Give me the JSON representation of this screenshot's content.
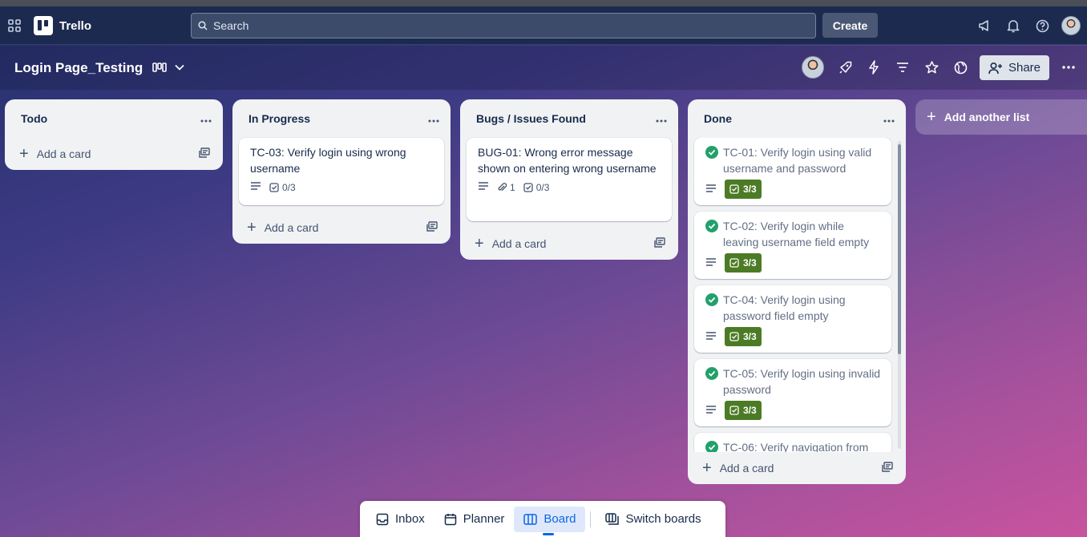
{
  "app": {
    "name": "Trello"
  },
  "topbar": {
    "search_placeholder": "Search",
    "create_label": "Create"
  },
  "board": {
    "title": "Login Page_Testing",
    "share_label": "Share"
  },
  "lists": [
    {
      "title": "Todo",
      "add_card": "Add a card",
      "cards": []
    },
    {
      "title": "In Progress",
      "add_card": "Add a card",
      "cards": [
        {
          "title": "TC-03: Verify login using wrong username",
          "checklist": "0/3"
        }
      ]
    },
    {
      "title": "Bugs / Issues Found",
      "add_card": "Add a card",
      "cards": [
        {
          "title": "BUG-01: Wrong error message shown on entering wrong username",
          "attachments": "1",
          "checklist": "0/3"
        }
      ]
    },
    {
      "title": "Done",
      "add_card": "Add a card",
      "cards": [
        {
          "title": "TC-01: Verify login using valid username and password",
          "checklist": "3/3"
        },
        {
          "title": "TC-02: Verify login while leaving username field empty",
          "checklist": "3/3"
        },
        {
          "title": "TC-04: Verify login using password field empty",
          "checklist": "3/3"
        },
        {
          "title": "TC-05: Verify login using invalid password",
          "checklist": "3/3"
        },
        {
          "title": "TC-06: Verify navigation from"
        }
      ]
    }
  ],
  "add_list_label": "Add another list",
  "bottom_nav": {
    "inbox": "Inbox",
    "planner": "Planner",
    "board": "Board",
    "switch": "Switch boards"
  },
  "colors": {
    "topbar": "#1d2a4f",
    "complete_badge": "#4c7b25",
    "complete_check": "#22a06b",
    "active_nav": "#0c66e4"
  }
}
